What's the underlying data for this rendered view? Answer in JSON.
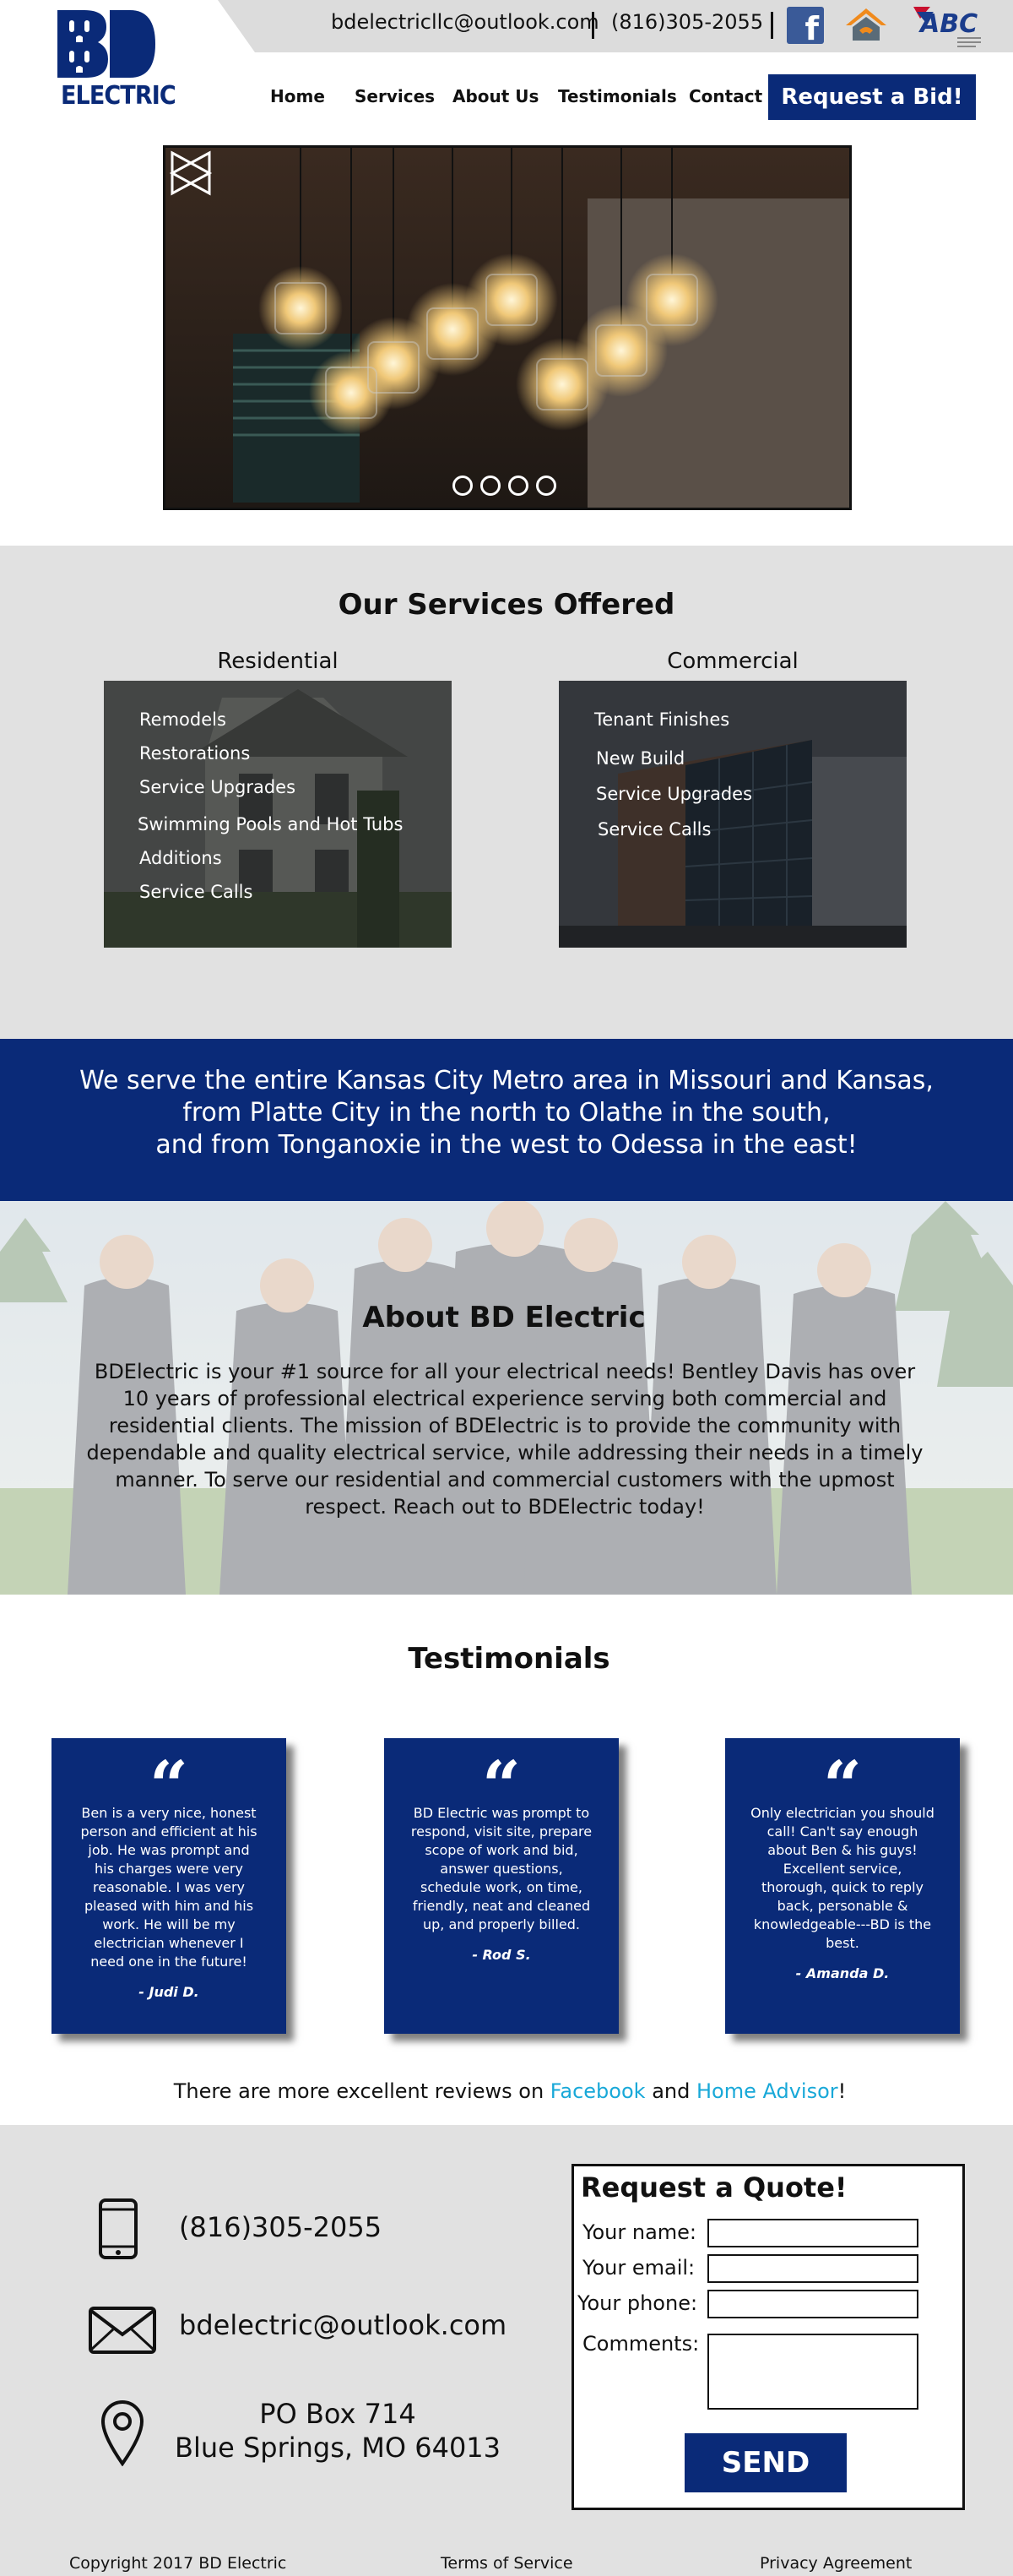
{
  "header": {
    "logo_text": "ELECTRIC",
    "logo_letters": "BD",
    "email": "bdelectricllc@outlook.com",
    "phone": "(816)305-2055",
    "facebook_letter": "f",
    "nav": [
      "Home",
      "Services",
      "About Us",
      "Testimonials",
      "Contact"
    ],
    "cta": "Request a Bid!",
    "abc_text": "ABC"
  },
  "slider": {
    "slide_count": 4,
    "prev_icon": "triangle-left-outline",
    "next_icon": "triangle-right-outline"
  },
  "services": {
    "title": "Our Services Offered",
    "residential": {
      "label": "Residential",
      "items": [
        "Remodels",
        "Restorations",
        "Service Upgrades",
        "Swimming Pools and Hot Tubs",
        "Additions",
        "Service Calls"
      ]
    },
    "commercial": {
      "label": "Commercial",
      "items": [
        "Tenant Finishes",
        "New Build",
        "Service Upgrades",
        "Service Calls"
      ]
    }
  },
  "coverage": {
    "lines": [
      "We serve the entire Kansas City Metro area in Missouri and Kansas,",
      "from Platte City in the north to Olathe in the south,",
      "and from Tonganoxie in the west to Odessa in the east!"
    ]
  },
  "about": {
    "title": "About BD Electric",
    "body": "BDElectric is your #1 source for all your electrical needs! Bentley Davis has over 10 years of professional electrical experience serving both commercial and residential clients. The mission of BDElectric is to provide the community with dependable and quality electrical service, while addressing their needs in a timely manner. To serve our residential and commercial customers with the upmost respect. Reach out to BDElectric today!"
  },
  "testimonials": {
    "title": "Testimonials",
    "quote_mark": "“",
    "items": [
      {
        "text": "Ben is a very nice, honest person and efficient at his job. He was prompt and his charges were very reasonable. I was very pleased with him and his work. He will be my electrician whenever I need one in the future!",
        "author": "- Judi D."
      },
      {
        "text": "BD Electric was prompt to respond, visit site, prepare scope of work and bid, answer questions, schedule work, on time, friendly, neat and cleaned up, and properly billed.",
        "author": "- Rod S."
      },
      {
        "text": "Only electrician you should call! Can't say enough about Ben & his guys! Excellent service, thorough, quick to reply back, personable & knowledgeable---BD is the best.",
        "author": "- Amanda D."
      }
    ],
    "more_prefix": "There are more excellent reviews on ",
    "more_link1": "Facebook",
    "more_and": " and ",
    "more_link2": "Home Advisor",
    "more_suffix": "!"
  },
  "contact": {
    "phone": "(816)305-2055",
    "email": "bdelectric@outlook.com",
    "address_line1": "PO Box 714",
    "address_line2": "Blue Springs, MO 64013"
  },
  "quote_form": {
    "title": "Request a Quote!",
    "name_label": "Your name:",
    "email_label": "Your email:",
    "phone_label": "Your phone:",
    "comments_label": "Comments:",
    "send": "SEND"
  },
  "footer": {
    "copyright": "Copyright 2017 BD Electric",
    "terms": "Terms of Service",
    "privacy": "Privacy Agreement"
  },
  "colors": {
    "brand_blue": "#0a2a78",
    "link_blue": "#18a8d8",
    "panel_gray": "#e1e1e1"
  }
}
